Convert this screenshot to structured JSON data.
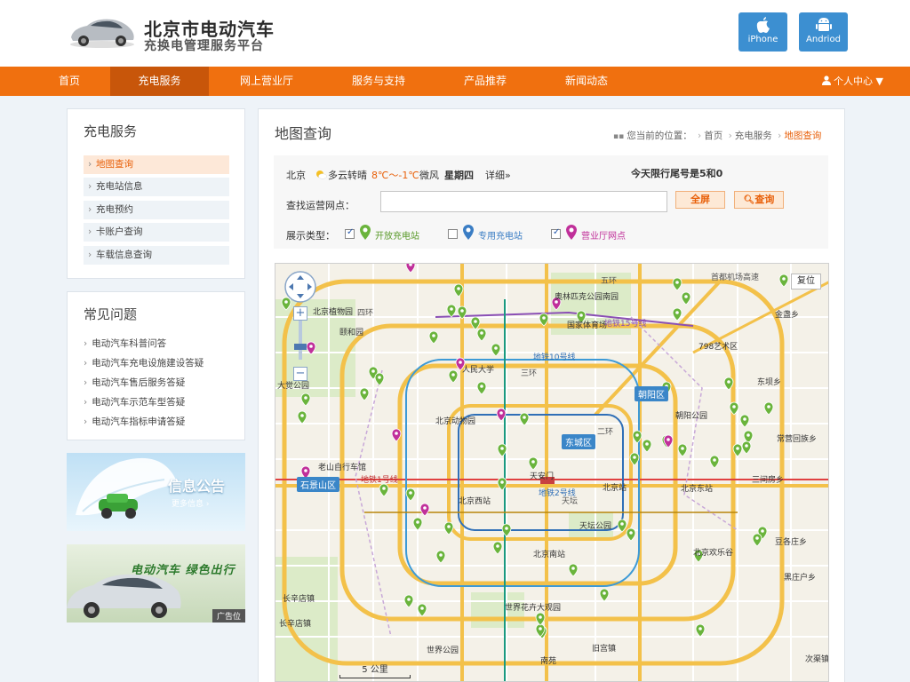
{
  "header": {
    "title": "北京市电动汽车",
    "subtitle": "充换电管理服务平台",
    "iphone_label": "iPhone",
    "android_label": "Andriod"
  },
  "nav": {
    "items": [
      {
        "label": "首页"
      },
      {
        "label": "充电服务"
      },
      {
        "label": "网上营业厅"
      },
      {
        "label": "服务与支持"
      },
      {
        "label": "产品推荐"
      },
      {
        "label": "新闻动态"
      }
    ],
    "user_center": "个人中心 ▼"
  },
  "sidebar": {
    "title": "充电服务",
    "items": [
      {
        "label": "地图查询"
      },
      {
        "label": "充电站信息"
      },
      {
        "label": "充电预约"
      },
      {
        "label": "卡账户查询"
      },
      {
        "label": "车载信息查询"
      }
    ]
  },
  "faq": {
    "title": "常见问题",
    "items": [
      {
        "label": "电动汽车科普问答"
      },
      {
        "label": "电动汽车充电设施建设答疑"
      },
      {
        "label": "电动汽车售后服务答疑"
      },
      {
        "label": "电动汽车示范车型答疑"
      },
      {
        "label": "电动汽车指标申请答疑"
      }
    ]
  },
  "banners": {
    "notice_title": "信息公告",
    "notice_more": "更多信息 ›",
    "ad_slogan": "电动汽车 绿色出行",
    "ad_tag": "广告位"
  },
  "main": {
    "title": "地图查询",
    "breadcrumb": {
      "prefix": "您当前的位置：",
      "home": "首页",
      "level2": "充电服务",
      "current": "地图查询"
    }
  },
  "search": {
    "city": "北京",
    "weather": "多云转晴",
    "temp": "8℃～-1℃",
    "wind": "微风",
    "weekday": "星期四",
    "detail": "详细»",
    "restriction": "今天限行尾号是5和0",
    "field_label": "查找运营网点：",
    "input_value": "",
    "fullscreen_label": "全屏",
    "query_label": "查询",
    "type_label": "展示类型：",
    "types": [
      {
        "label": "开放充电站",
        "checked": true
      },
      {
        "label": "专用充电站",
        "checked": false
      },
      {
        "label": "营业厅网点",
        "checked": true
      }
    ]
  },
  "map": {
    "reset_label": "复位",
    "scale_label": "5 公里",
    "districts": [
      {
        "label": "朝阳区"
      },
      {
        "label": "东城区"
      },
      {
        "label": "石景山区"
      }
    ],
    "places": [
      {
        "label": "北京植物园"
      },
      {
        "label": "颐和园"
      },
      {
        "label": "人民大学"
      },
      {
        "label": "北京动物园"
      },
      {
        "label": "天安门"
      },
      {
        "label": "北京站"
      },
      {
        "label": "北京西站"
      },
      {
        "label": "北京南站"
      },
      {
        "label": "北京东站"
      },
      {
        "label": "天坛公园"
      },
      {
        "label": "世界公园"
      },
      {
        "label": "世界花卉大观园"
      },
      {
        "label": "798艺术区"
      },
      {
        "label": "金盏乡"
      },
      {
        "label": "东坝乡"
      },
      {
        "label": "朝阳公园"
      },
      {
        "label": "常营回族乡"
      },
      {
        "label": "三间房乡"
      },
      {
        "label": "豆各庄乡"
      },
      {
        "label": "北京欢乐谷"
      },
      {
        "label": "黑庄户乡"
      },
      {
        "label": "老山自行车馆"
      },
      {
        "label": "国家体育场"
      },
      {
        "label": "奥林匹克公园南园"
      },
      {
        "label": "长辛店镇"
      },
      {
        "label": "长辛店镇"
      },
      {
        "label": "旧宫镇"
      },
      {
        "label": "南苑"
      },
      {
        "label": "次渠镇"
      },
      {
        "label": "大觉公园"
      },
      {
        "label": "地铁1号线"
      },
      {
        "label": "地铁2号线"
      },
      {
        "label": "地铁10号线"
      },
      {
        "label": "地铁15号线"
      },
      {
        "label": "首都机场高速"
      },
      {
        "label": "天坛"
      },
      {
        "label": "五环"
      },
      {
        "label": "四环"
      },
      {
        "label": "三环"
      },
      {
        "label": "二环"
      }
    ]
  },
  "colors": {
    "nav_orange": "#f0700f",
    "nav_active": "#c8560a",
    "accent": "#e8600a",
    "app_button": "#3c8fd1"
  }
}
